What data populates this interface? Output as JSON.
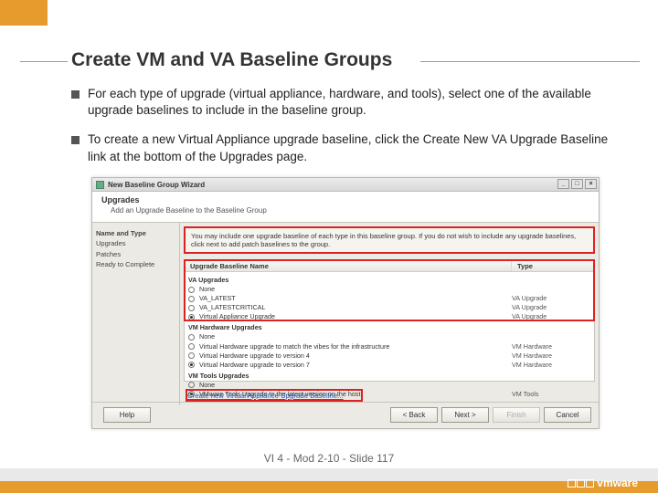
{
  "title": "Create VM and VA Baseline Groups",
  "bullets": [
    "For each type of upgrade (virtual appliance, hardware, and tools), select one of the available upgrade baselines to include in the baseline group.",
    "To create a new Virtual Appliance upgrade baseline, click the Create New VA Upgrade Baseline link at the bottom of the Upgrades page."
  ],
  "wizard": {
    "window_title": "New Baseline Group Wizard",
    "header_title": "Upgrades",
    "header_sub": "Add an Upgrade Baseline to the Baseline Group",
    "sidebar": [
      "Name and Type",
      "Upgrades",
      "Patches",
      "Ready to Complete"
    ],
    "note": "You may include one upgrade baseline of each type in this baseline group. If you do not wish to include any upgrade baselines, click next to add patch baselines to the group.",
    "col_name": "Upgrade Baseline Name",
    "col_type": "Type",
    "groups": [
      {
        "label": "VA Upgrades",
        "rows": [
          {
            "text": "None",
            "type": "",
            "selected": false
          },
          {
            "text": "VA_LATEST",
            "type": "VA Upgrade",
            "selected": false
          },
          {
            "text": "VA_LATESTCRITICAL",
            "type": "VA Upgrade",
            "selected": false
          },
          {
            "text": "Virtual Appliance Upgrade",
            "type": "VA Upgrade",
            "selected": true
          }
        ]
      },
      {
        "label": "VM Hardware Upgrades",
        "rows": [
          {
            "text": "None",
            "type": "",
            "selected": false
          },
          {
            "text": "Virtual Hardware upgrade to match the vibes for the infrastructure",
            "type": "VM Hardware",
            "selected": false
          },
          {
            "text": "Virtual Hardware upgrade to version 4",
            "type": "VM Hardware",
            "selected": false
          },
          {
            "text": "Virtual Hardware upgrade to version 7",
            "type": "VM Hardware",
            "selected": true
          }
        ]
      },
      {
        "label": "VM Tools Upgrades",
        "rows": [
          {
            "text": "None",
            "type": "",
            "selected": false
          },
          {
            "text": "VMware Tools Upgrade to the latest version on the host",
            "type": "VM Tools",
            "selected": true
          }
        ]
      }
    ],
    "link": "Create new Virtual Appliance Upgrade Baseline...",
    "buttons": {
      "help": "Help",
      "back": "< Back",
      "next": "Next >",
      "finish": "Finish",
      "cancel": "Cancel"
    }
  },
  "footer": {
    "slide": "VI 4 - Mod 2-10 - Slide 117",
    "brand": "vmware"
  }
}
